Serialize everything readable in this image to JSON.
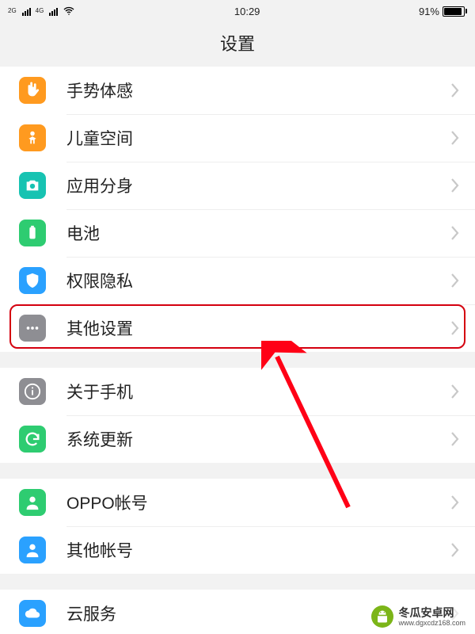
{
  "status": {
    "signal_left_label": "2G",
    "signal_right_label": "4G",
    "time": "10:29",
    "battery_pct_label": "91%",
    "battery_pct": 91
  },
  "title": "设置",
  "groups": [
    {
      "rows": [
        {
          "id": "gesture",
          "label": "手势体感",
          "icon": "hand-icon",
          "color": "#ff9a1f"
        },
        {
          "id": "kids",
          "label": "儿童空间",
          "icon": "child-icon",
          "color": "#ff9a1f"
        },
        {
          "id": "appclone",
          "label": "应用分身",
          "icon": "camera-icon",
          "color": "#17c3b2"
        },
        {
          "id": "battery",
          "label": "电池",
          "icon": "battery-icon",
          "color": "#2ecc71"
        },
        {
          "id": "privacy",
          "label": "权限隐私",
          "icon": "shield-icon",
          "color": "#2aa1ff"
        },
        {
          "id": "other",
          "label": "其他设置",
          "icon": "more-icon",
          "color": "#8e8e93"
        }
      ]
    },
    {
      "rows": [
        {
          "id": "about",
          "label": "关于手机",
          "icon": "info-icon",
          "color": "#8e8e93"
        },
        {
          "id": "update",
          "label": "系统更新",
          "icon": "refresh-icon",
          "color": "#2ecc71"
        }
      ]
    },
    {
      "rows": [
        {
          "id": "oppoacct",
          "label": "OPPO帐号",
          "icon": "person-icon",
          "color": "#2ecc71"
        },
        {
          "id": "otheracct",
          "label": "其他帐号",
          "icon": "person-icon",
          "color": "#2aa1ff"
        }
      ]
    },
    {
      "rows": [
        {
          "id": "cloud",
          "label": "云服务",
          "icon": "cloud-icon",
          "color": "#2aa1ff"
        }
      ]
    }
  ],
  "annotation": {
    "highlighted_row_id": "other",
    "arrow_from": "bottom-right",
    "arrow_to": "other"
  },
  "watermark": {
    "brand": "冬瓜安卓网",
    "url": "www.dgxcdz168.com"
  }
}
